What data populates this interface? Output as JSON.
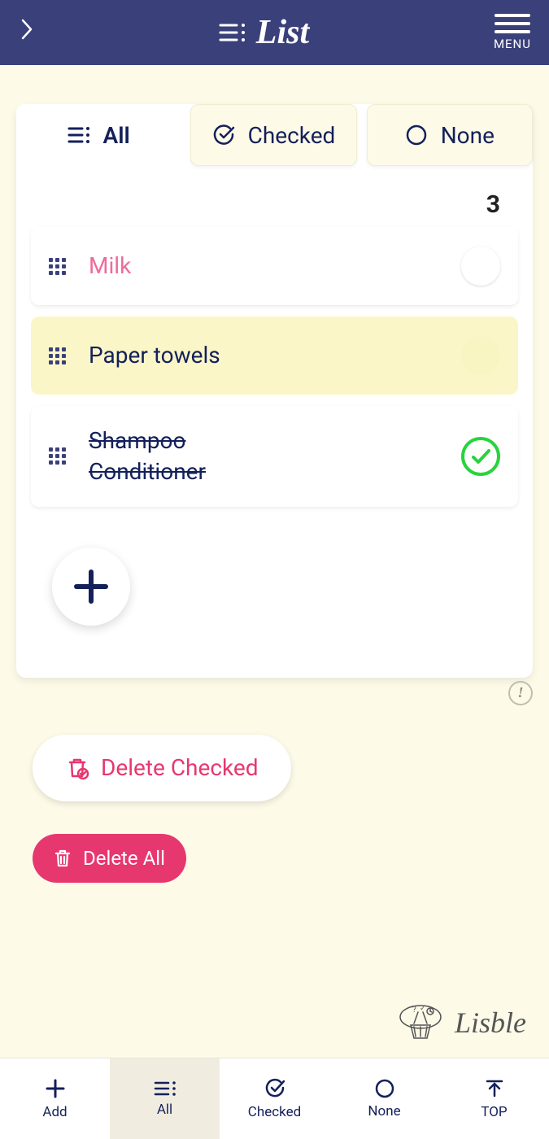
{
  "header": {
    "title": "List",
    "menu_label": "MENU"
  },
  "tabs": {
    "all": "All",
    "checked": "Checked",
    "none": "None",
    "active": "all"
  },
  "count": "3",
  "items": [
    {
      "text": "Milk",
      "style": "pink",
      "checked": false,
      "background": "white"
    },
    {
      "text": "Paper towels",
      "style": "normal",
      "checked": false,
      "background": "yellow"
    },
    {
      "text": "Shampoo\nConditioner",
      "style": "done",
      "checked": true,
      "background": "white"
    }
  ],
  "buttons": {
    "delete_checked": "Delete Checked",
    "delete_all": "Delete All"
  },
  "brand": "Lisble",
  "bottom": {
    "add": "Add",
    "all": "All",
    "checked": "Checked",
    "none": "None",
    "top": "TOP",
    "active": "all"
  }
}
